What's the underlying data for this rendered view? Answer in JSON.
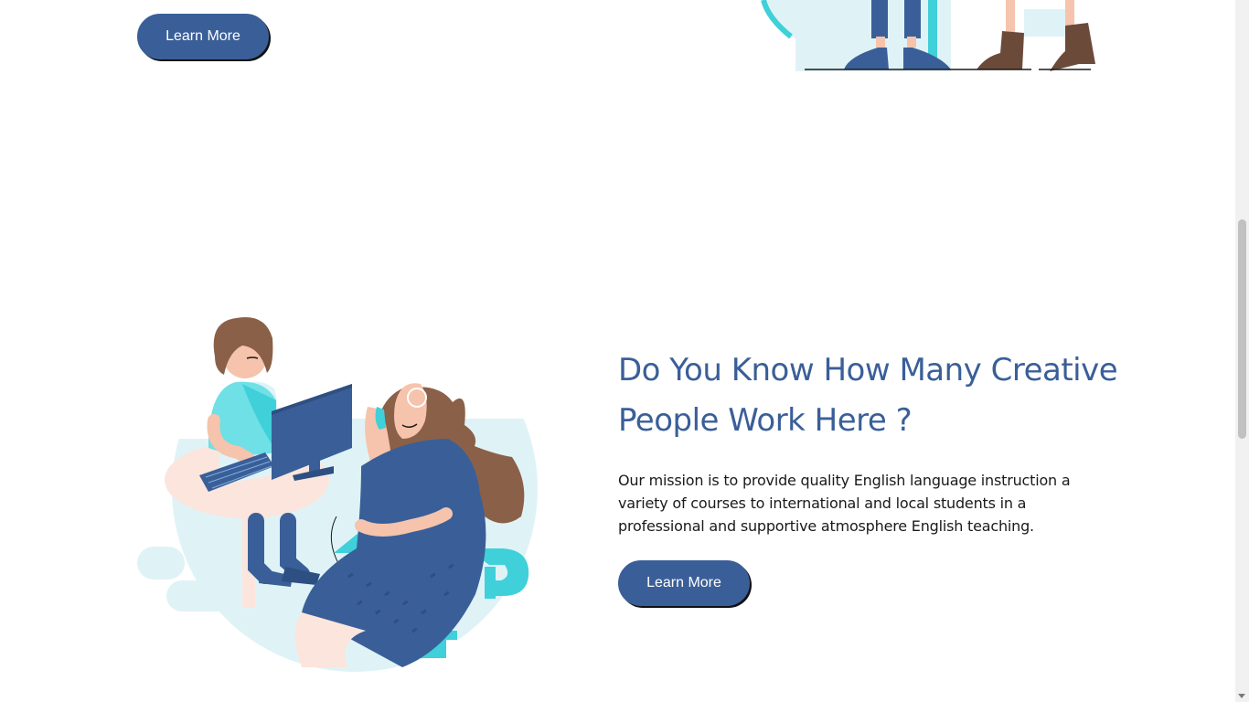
{
  "sections": {
    "top": {
      "cta_label": "Learn More"
    },
    "about": {
      "heading": "Do You Know How Many Creative People Work Here ?",
      "paragraph": "Our mission is to provide quality English language instruction a variety of courses to international and local students in a professional and supportive atmosphere English teaching.",
      "cta_label": "Learn More"
    }
  },
  "colors": {
    "primary": "#3a5f98",
    "accent_cyan": "#3fd0d9",
    "light_cyan": "#dff3f7",
    "skin": "#f6c3ac",
    "hair": "#8b6048"
  }
}
